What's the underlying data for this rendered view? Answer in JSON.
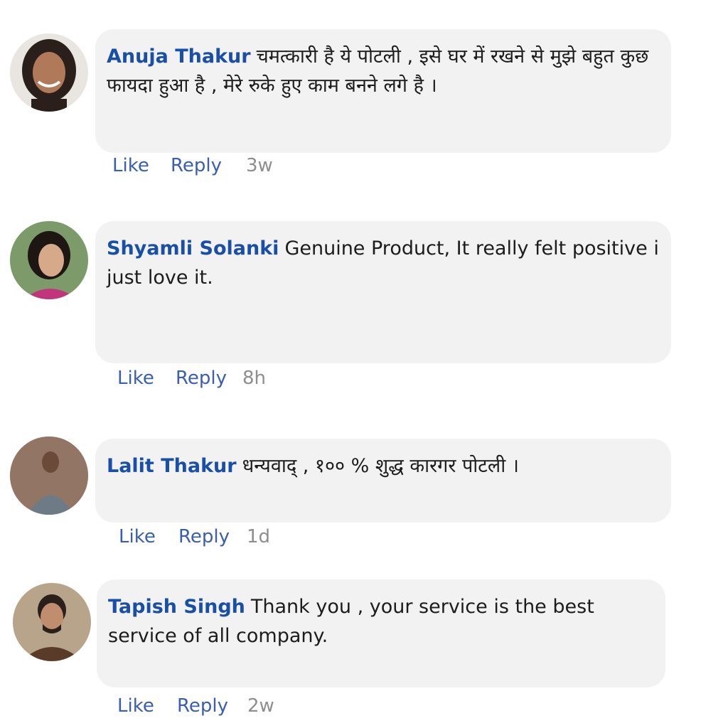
{
  "comments": [
    {
      "author": "Anuja Thakur",
      "text": "चमत्कारी है ये पोटली , इसे घर में रखने से मुझे बहुत कुछ फायदा हुआ है , मेरे रुके हुए काम बनने लगे है ।",
      "like_label": "Like",
      "reply_label": "Reply",
      "time": "3w"
    },
    {
      "author": "Shyamli Solanki",
      "text": "Genuine Product, It really felt positive i just love it.",
      "like_label": "Like",
      "reply_label": "Reply",
      "time": "8h"
    },
    {
      "author": "Lalit Thakur",
      "text": "धन्यवाद् , १०० % शुद्ध कारगर पोटली ।",
      "like_label": "Like",
      "reply_label": "Reply",
      "time": "1d"
    },
    {
      "author": "Tapish Singh",
      "text": "Thank you , your service is the best service of all company.",
      "like_label": "Like",
      "reply_label": "Reply",
      "time": "2w"
    }
  ],
  "colors": {
    "author": "#1a4fa8",
    "action_link": "#3a5fb0",
    "timestamp": "#8e8e8e",
    "bubble": "#f2f2f2"
  }
}
